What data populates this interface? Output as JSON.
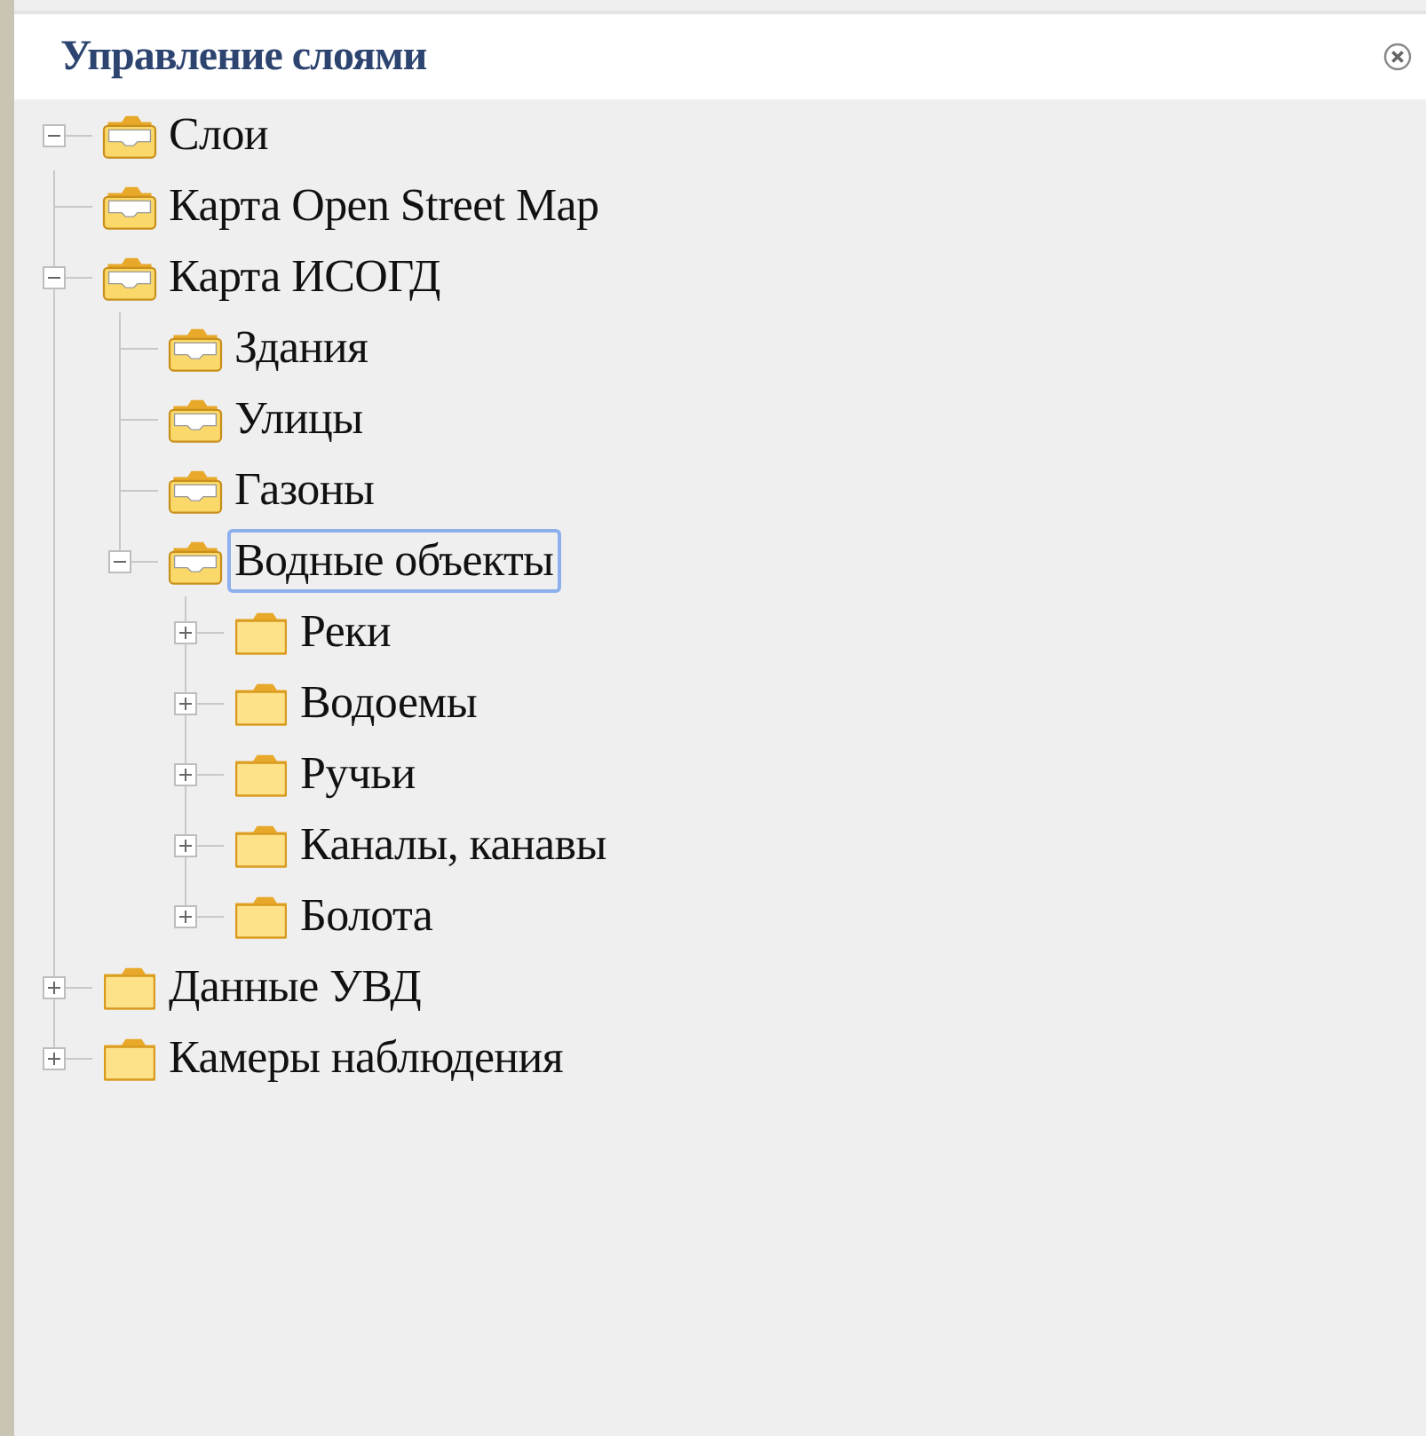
{
  "panel": {
    "title": "Управление слоями"
  },
  "tree": [
    {
      "label": "Слои",
      "expanded": true,
      "selected": false,
      "children": [
        {
          "label": "Карта Open Street Map",
          "selected": false
        },
        {
          "label": "Карта ИСОГД",
          "expanded": true,
          "selected": false,
          "children": [
            {
              "label": "Здания",
              "selected": false
            },
            {
              "label": "Улицы",
              "selected": false
            },
            {
              "label": "Газоны",
              "selected": false
            },
            {
              "label": "Водные объекты",
              "expanded": true,
              "selected": true,
              "children": [
                {
                  "label": "Реки",
                  "expanded": false,
                  "selected": false
                },
                {
                  "label": "Водоемы",
                  "expanded": false,
                  "selected": false
                },
                {
                  "label": "Ручьи",
                  "expanded": false,
                  "selected": false
                },
                {
                  "label": "Каналы, канавы",
                  "expanded": false,
                  "selected": false
                },
                {
                  "label": "Болота",
                  "expanded": false,
                  "selected": false
                }
              ]
            }
          ]
        },
        {
          "label": "Данные УВД",
          "expanded": false,
          "selected": false
        },
        {
          "label": "Камеры наблюдения",
          "expanded": false,
          "selected": false
        }
      ]
    }
  ]
}
